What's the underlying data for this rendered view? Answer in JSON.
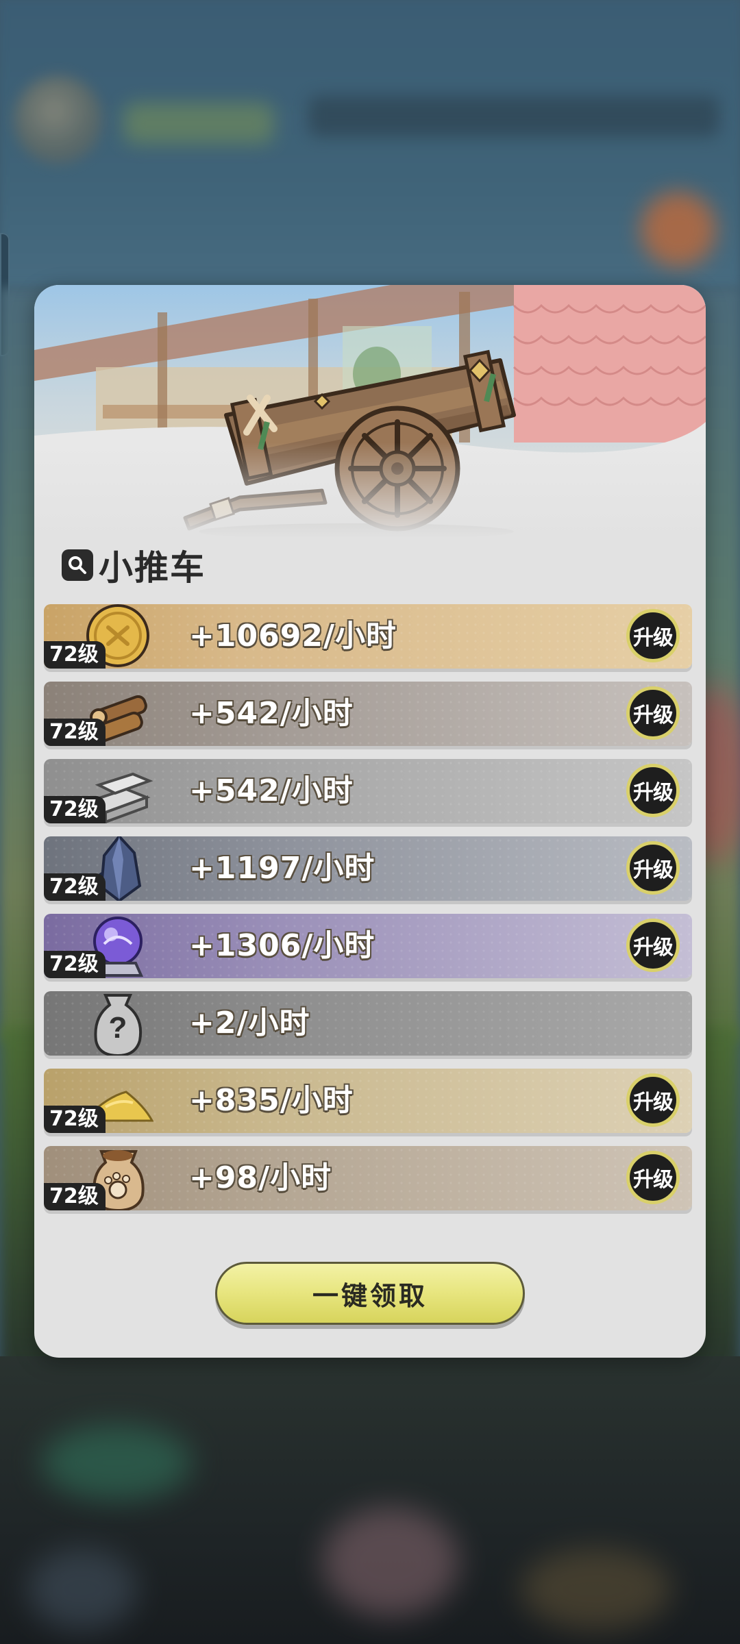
{
  "panel": {
    "title": "小推车"
  },
  "resources": [
    {
      "id": "gold",
      "level": "72级",
      "rate": "+10692/小时",
      "upgrade": "升级",
      "icon": "gold-coin-icon"
    },
    {
      "id": "wood",
      "level": "72级",
      "rate": "+542/小时",
      "upgrade": "升级",
      "icon": "wood-logs-icon"
    },
    {
      "id": "stone",
      "level": "72级",
      "rate": "+542/小时",
      "upgrade": "升级",
      "icon": "stone-bricks-icon"
    },
    {
      "id": "crystal",
      "level": "72级",
      "rate": "+1197/小时",
      "upgrade": "升级",
      "icon": "crystal-icon"
    },
    {
      "id": "orb",
      "level": "72级",
      "rate": "+1306/小时",
      "upgrade": "升级",
      "icon": "purple-orb-icon"
    },
    {
      "id": "mystery",
      "level": "",
      "rate": "+2/小时",
      "upgrade": "",
      "icon": "mystery-sack-icon"
    },
    {
      "id": "sand",
      "level": "72级",
      "rate": "+835/小时",
      "upgrade": "升级",
      "icon": "sand-pile-icon"
    },
    {
      "id": "sack",
      "level": "72级",
      "rate": "+98/小时",
      "upgrade": "升级",
      "icon": "paw-sack-icon"
    }
  ],
  "claim_all_label": "一键领取",
  "colors": {
    "upgrade_ring": "#d9d06a",
    "claim_button": "#e7e57e",
    "badge_bg": "#232323"
  }
}
